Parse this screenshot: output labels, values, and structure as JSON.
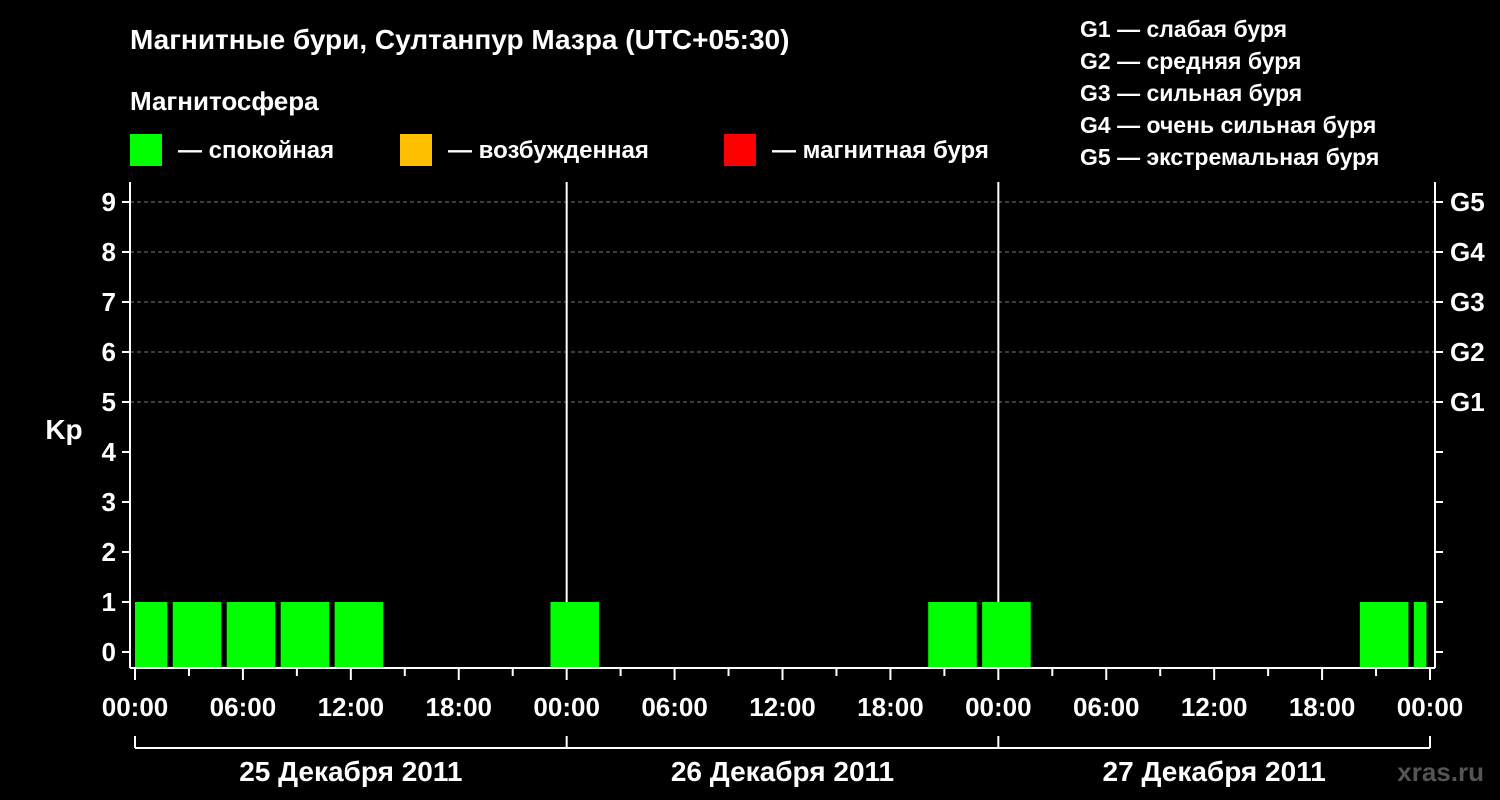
{
  "header": {
    "title": "Магнитные бури, Султанпур Мазра (UTC+05:30)",
    "subtitle": "Магнитосфера"
  },
  "legend": [
    {
      "label": "— спокойная",
      "color": "#00ff00"
    },
    {
      "label": "— возбужденная",
      "color": "#ffbf00"
    },
    {
      "label": "— магнитная буря",
      "color": "#ff0000"
    }
  ],
  "storm_scale": [
    "G1 — слабая буря",
    "G2 — средняя буря",
    "G3 — сильная буря",
    "G4 — очень сильная буря",
    "G5 — экстремальная буря"
  ],
  "watermark": "xras.ru",
  "chart_data": {
    "type": "bar",
    "ylabel": "Kp",
    "ylim": [
      0,
      9
    ],
    "yticks": [
      0,
      1,
      2,
      3,
      4,
      5,
      6,
      7,
      8,
      9
    ],
    "right_ticks": [
      {
        "kp": 5,
        "label": "G1"
      },
      {
        "kp": 6,
        "label": "G2"
      },
      {
        "kp": 7,
        "label": "G3"
      },
      {
        "kp": 8,
        "label": "G4"
      },
      {
        "kp": 9,
        "label": "G5"
      }
    ],
    "xlim_hours": [
      0,
      72
    ],
    "xticks": [
      {
        "h": 0,
        "label": "00:00"
      },
      {
        "h": 6,
        "label": "06:00"
      },
      {
        "h": 12,
        "label": "12:00"
      },
      {
        "h": 18,
        "label": "18:00"
      },
      {
        "h": 24,
        "label": "00:00"
      },
      {
        "h": 30,
        "label": "06:00"
      },
      {
        "h": 36,
        "label": "12:00"
      },
      {
        "h": 42,
        "label": "18:00"
      },
      {
        "h": 48,
        "label": "00:00"
      },
      {
        "h": 54,
        "label": "06:00"
      },
      {
        "h": 60,
        "label": "12:00"
      },
      {
        "h": 66,
        "label": "18:00"
      },
      {
        "h": 72,
        "label": "00:00"
      }
    ],
    "days": [
      {
        "label": "25 Декабря 2011",
        "start": 0,
        "end": 24
      },
      {
        "label": "26 Декабря 2011",
        "start": 24,
        "end": 48
      },
      {
        "label": "27 Декабря 2011",
        "start": 48,
        "end": 72
      }
    ],
    "bars": [
      {
        "start": 0.0,
        "end": 1.8,
        "kp": 1,
        "level": "quiet"
      },
      {
        "start": 2.1,
        "end": 4.8,
        "kp": 1,
        "level": "quiet"
      },
      {
        "start": 5.1,
        "end": 7.8,
        "kp": 1,
        "level": "quiet"
      },
      {
        "start": 8.1,
        "end": 10.8,
        "kp": 1,
        "level": "quiet"
      },
      {
        "start": 11.1,
        "end": 13.8,
        "kp": 1,
        "level": "quiet"
      },
      {
        "start": 23.1,
        "end": 25.8,
        "kp": 1,
        "level": "quiet"
      },
      {
        "start": 44.1,
        "end": 46.8,
        "kp": 1,
        "level": "quiet"
      },
      {
        "start": 47.1,
        "end": 49.8,
        "kp": 1,
        "level": "quiet"
      },
      {
        "start": 68.1,
        "end": 70.8,
        "kp": 1,
        "level": "quiet"
      },
      {
        "start": 71.1,
        "end": 71.8,
        "kp": 1,
        "level": "quiet"
      }
    ],
    "level_colors": {
      "quiet": "#00ff00",
      "active": "#ffbf00",
      "storm": "#ff0000"
    }
  }
}
